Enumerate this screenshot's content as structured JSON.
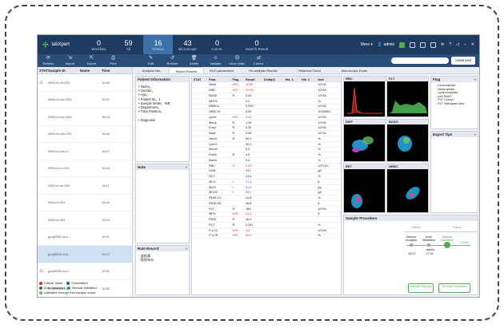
{
  "app": {
    "name": "labXpert"
  },
  "nav": [
    {
      "count": "0",
      "label": "Worklists"
    },
    {
      "count": "59",
      "label": "All"
    },
    {
      "count": "16",
      "label": "Review",
      "active": true
    },
    {
      "count": "43",
      "label": "Microscopic"
    },
    {
      "count": "0",
      "label": "Comm."
    },
    {
      "count": "0",
      "label": "Search Result"
    }
  ],
  "top_right": {
    "more": "More",
    "user": "admin"
  },
  "toolbar": [
    "Refresh",
    "Import",
    "Export",
    "Print",
    "Edit",
    "Restore",
    "Delete",
    "Validate",
    "Undo Valid.",
    "Comm."
  ],
  "search": {
    "placeholder": "",
    "advanced": "Advanced"
  },
  "sample_list": {
    "headers": [
      "STAT",
      "Sample ID",
      "Name",
      "Time"
    ],
    "rows": [
      {
        "stat": "⚠",
        "id": "0900-bl-cd-003",
        "name": "",
        "time": "15:00",
        "warn": true
      },
      {
        "stat": "",
        "id": "0900-bl-cbc-003",
        "name": "",
        "time": "15:01"
      },
      {
        "stat": "",
        "id": "0900-bl-cbc-003",
        "name": "",
        "time": "15:04"
      },
      {
        "stat": "",
        "id": "0900-bl-cdn-003",
        "name": "",
        "time": "15:06"
      },
      {
        "stat": "",
        "id": "0900-bl-cdn-0...",
        "name": "",
        "time": "15:07"
      },
      {
        "stat": "",
        "id": "0900-bl-cr-003",
        "name": "",
        "time": "15:09"
      },
      {
        "stat": "",
        "id": "0900-bl-ret-003",
        "name": "",
        "time": "15:11"
      },
      {
        "stat": "",
        "id": "0900-bl-001",
        "name": "",
        "time": "15:16"
      },
      {
        "stat": "",
        "id": "0900-bl-002",
        "name": "",
        "time": "15:19"
      },
      {
        "stat": "",
        "id": "guoji0000-bl-c...",
        "name": "",
        "time": "15:21"
      },
      {
        "stat": "",
        "id": "guoji0000-bl-c...",
        "name": "",
        "time": "15:27",
        "selected": true
      },
      {
        "stat": "⚠",
        "id": "guoji0000-bl-c...",
        "name": "",
        "time": "15:31",
        "warn": true
      },
      {
        "stat": "",
        "id": "0900-bl-cd-001",
        "name": "",
        "time": "15:32"
      },
      {
        "stat": "",
        "id": "guoji0000-bl-c...",
        "name": "",
        "time": "15:33"
      },
      {
        "stat": "",
        "id": "guoji0000-bl-c...",
        "name": "",
        "time": "10:02"
      }
    ]
  },
  "legend": [
    "Critical Value",
    "Transmitted",
    "Auto Validated",
    "Manual Validated",
    "Validated through microscopic exam"
  ],
  "tabs": [
    "Analysis Info",
    "Report Results",
    "RUO parameters",
    "Re-analysis Results",
    "Historical Trend",
    "Microscopic Exam"
  ],
  "patient_info": {
    "title": "Patient Information",
    "lines": [
      "• Name。",
      "• Gender。",
      "• Age。",
      "• Patient ID。1",
      "• Sample Mode。WB",
      "• Department。",
      "• Tube Position。",
      "",
      "• Diagnosis"
    ]
  },
  "note": {
    "title": "Note"
  },
  "rule_record": {
    "title": "Rule Record",
    "lines": [
      "- 血栓通",
      "- 规则Test"
    ]
  },
  "results": {
    "headers": [
      "STAT",
      "Para.",
      "Flag",
      "Result",
      "Delta(#)",
      "His. 1",
      "His. 2",
      "Unit"
    ],
    "rows": [
      [
        "",
        "Neu#",
        "H/R",
        "11.82",
        "",
        "",
        "",
        "10^9/L",
        "red"
      ],
      [
        "",
        "WBC",
        "H/R",
        "20.00",
        "",
        "",
        "",
        "10^9/L",
        "red"
      ],
      [
        "",
        "BAS#",
        "R",
        "0.04",
        "",
        "",
        "",
        "10^9/L",
        ""
      ],
      [
        "",
        "IMG%",
        "",
        "0.2",
        "",
        "",
        "",
        "%",
        ""
      ],
      [
        "",
        "NRBC#",
        "",
        "0.000",
        "",
        "",
        "",
        "10^9/L",
        ""
      ],
      [
        "",
        "NRBC%",
        "",
        "0.00",
        "",
        "",
        "",
        "/100WBC",
        ""
      ],
      [
        "",
        "Lym#",
        "H/R",
        "3.94",
        "",
        "",
        "",
        "10^9/L",
        "red"
      ],
      [
        "",
        "Mon#",
        "R",
        "1.06",
        "",
        "",
        "",
        "10^9/L",
        ""
      ],
      [
        "",
        "Eos#",
        "R",
        "0.30",
        "",
        "",
        "",
        "10^9/L",
        ""
      ],
      [
        "",
        "Bas#",
        "R",
        "0.08",
        "",
        "",
        "",
        "10^9/L",
        ""
      ],
      [
        "",
        "Neu%",
        "R",
        "59.0",
        "",
        "",
        "",
        "%",
        ""
      ],
      [
        "",
        "Lym%",
        "",
        "20.2",
        "",
        "",
        "",
        "%",
        ""
      ],
      [
        "",
        "Mon%",
        "",
        "5.3",
        "",
        "",
        "",
        "%",
        ""
      ],
      [
        "",
        "Eos%",
        "R",
        "1.5",
        "",
        "",
        "",
        "%",
        ""
      ],
      [
        "",
        "Bas%",
        "",
        "0.4",
        "",
        "",
        "",
        "%",
        ""
      ],
      [
        "",
        "RBC",
        "H",
        "0.29",
        "",
        "",
        "",
        "10^12/L",
        "red"
      ],
      [
        "",
        "HGB",
        "",
        "121",
        "",
        "",
        "",
        "g/L",
        ""
      ],
      [
        "",
        "HCT",
        "",
        "41.6",
        "",
        "",
        "",
        "%",
        ""
      ],
      [
        "",
        "MCV",
        "L",
        "74.4",
        "",
        "",
        "",
        "fL",
        "blue"
      ],
      [
        "",
        "MCH",
        "L",
        "21.6",
        "",
        "",
        "",
        "pg",
        "blue"
      ],
      [
        "",
        "MCHC",
        "L",
        "291",
        "",
        "",
        "",
        "g/L",
        "blue"
      ],
      [
        "",
        "RDW-CV",
        "",
        "14.8",
        "",
        "",
        "",
        "%",
        ""
      ],
      [
        "",
        "RDW-SD",
        "",
        "38.8",
        "",
        "",
        "",
        "fL",
        ""
      ],
      [
        "",
        "PLT",
        "R",
        "189",
        "",
        "",
        "",
        "10^9/L",
        ""
      ],
      [
        "",
        "MPV",
        "H/R",
        "13.4",
        "",
        "",
        "",
        "fL",
        "red"
      ],
      [
        "",
        "PDW",
        "R",
        "16.2",
        "",
        "",
        "",
        "",
        ""
      ],
      [
        "",
        "PCT",
        "R",
        "0.267",
        "",
        "",
        "",
        "%",
        ""
      ],
      [
        "",
        "P-LCC",
        "H/R",
        "117",
        "",
        "",
        "",
        "10^9/L",
        "red"
      ],
      [
        "",
        "P-LCR",
        "H/R",
        "60.9",
        "",
        "",
        "",
        "%",
        "red"
      ]
    ]
  },
  "scatter_titles": [
    "RBC",
    "PLT",
    "DIFF",
    "BASO",
    "RET",
    "NRBC"
  ],
  "flag_panel": {
    "title": "Flag",
    "items": [
      "- Leucocytosis",
      "- Neutrophilia",
      "- Lymphocytosis",
      "- Left Shift?",
      "- PLT Clump?",
      "- PLT Histogram Abn."
    ]
  },
  "expert_tips": {
    "title": "Expert Tips"
  },
  "sample_procedure": {
    "title": "Sample Procedure",
    "history": "History",
    "future": "Future",
    "steps": [
      "Sample Analysis",
      "Auto Validation",
      "Manual Validation",
      "Comm."
    ],
    "step_user": [
      "",
      "",
      "admin",
      ""
    ],
    "step_time": [
      "15:27",
      "17:22",
      "",
      ""
    ],
    "buttons": [
      "Refresh Sample",
      "To Undo Validation"
    ]
  }
}
